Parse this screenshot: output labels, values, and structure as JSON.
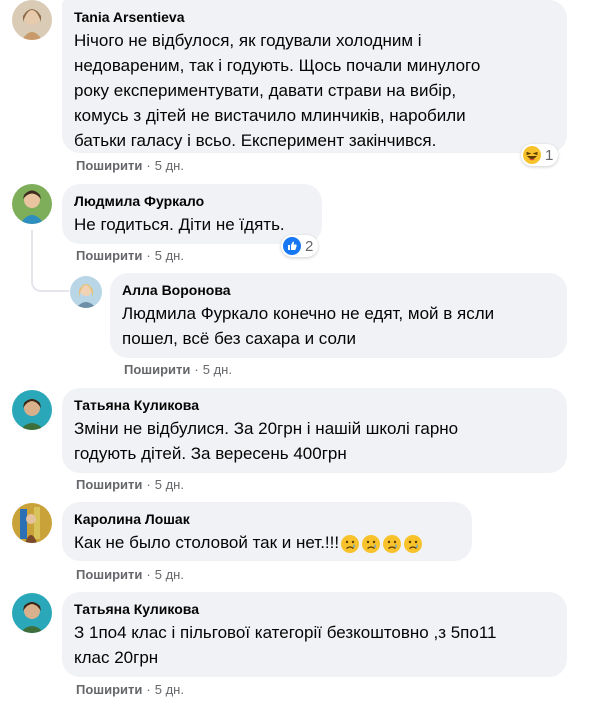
{
  "comments": [
    {
      "author": "Tania Arsentieva",
      "lines": [
        "Нічого не вiдбулося, як годували холодним і",
        "недовареним, так і годують. Щось почали минулого",
        "року експериментувати, давати страви на вибір,",
        "комусь з дітей не вистачило млинчиків, наробили",
        "батьки галасу і всьо. Експеримент закінчився."
      ],
      "share": "Поширити",
      "time": "5 дн.",
      "reaction": {
        "icon": "laughing-emoji",
        "count": "1"
      }
    },
    {
      "author": "Людмила Фуркало",
      "lines": [
        "Не годиться. Діти не їдять."
      ],
      "share": "Поширити",
      "time": "5 дн.",
      "reaction": {
        "icon": "like-icon",
        "count": "2"
      }
    },
    {
      "author": "Алла Воронова",
      "lines": [
        "Людмила Фуркало конечно не едят, мой в ясли",
        "пошел, всё без сахара и соли"
      ],
      "share": "Поширити",
      "time": "5 дн."
    },
    {
      "author": "Татьяна Куликова",
      "lines": [
        "Зміни не відбулися. За 20грн і нашій школі гарно",
        "годують дітей. За вересень 400грн"
      ],
      "share": "Поширити",
      "time": "5 дн."
    },
    {
      "author": "Каролина Лошак",
      "lines": [
        "Как не было столовой так и нет.!!!"
      ],
      "emojis": [
        "crying-face-emoji",
        "crying-face-emoji",
        "crying-face-emoji",
        "crying-face-emoji"
      ],
      "share": "Поширити",
      "time": "5 дн."
    },
    {
      "author": "Татьяна Куликова",
      "lines": [
        "З 1по4 клас і пільгової категорії безкоштовно ,з 5по11",
        "клас 20грн"
      ],
      "share": "Поширити",
      "time": "5 дн."
    }
  ],
  "colors": {
    "bubble": "#f0f2f5",
    "meta": "#65676b",
    "like_blue": "#1877f2"
  }
}
